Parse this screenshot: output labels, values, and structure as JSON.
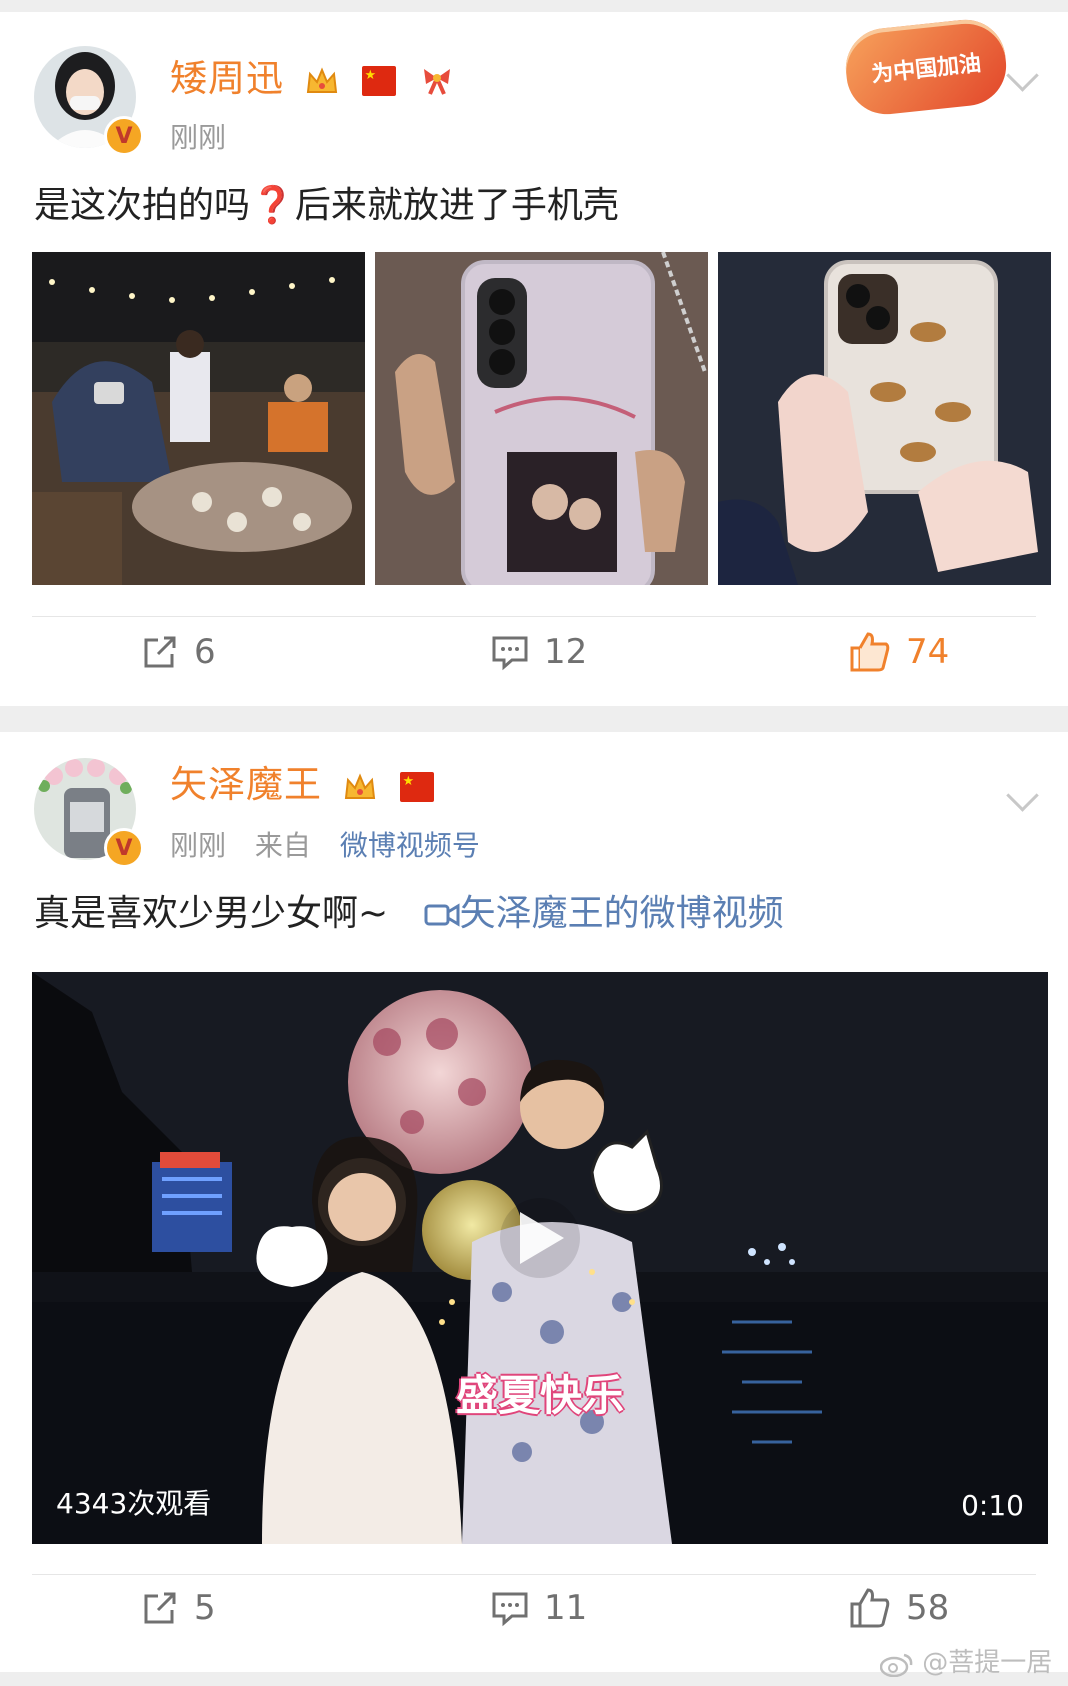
{
  "post1": {
    "username": "矮周迅",
    "time": "刚刚",
    "text": "是这次拍的吗❓后来就放进了手机壳",
    "promo_badge": "为中国加油",
    "repost_count": "6",
    "comment_count": "12",
    "like_count": "74",
    "icons": [
      "crown-icon",
      "china-flag-icon",
      "ribbon-bow-icon",
      "verified-badge-icon",
      "chevron-down-icon"
    ]
  },
  "post2": {
    "username": "矢泽魔王",
    "time": "刚刚",
    "source_prefix": "来自",
    "source": "微博视频号",
    "text": "真是喜欢少男少女啊~",
    "video_link": "矢泽魔王的微博视频",
    "video": {
      "caption": "盛夏快乐",
      "views": "4343次观看",
      "duration": "0:10"
    },
    "repost_count": "5",
    "comment_count": "11",
    "like_count": "58"
  },
  "watermark": "@菩提一居",
  "colors": {
    "username": "#f0812c",
    "link": "#5b7fb3",
    "like_active": "#f0812c",
    "background": "#eeeeee"
  }
}
